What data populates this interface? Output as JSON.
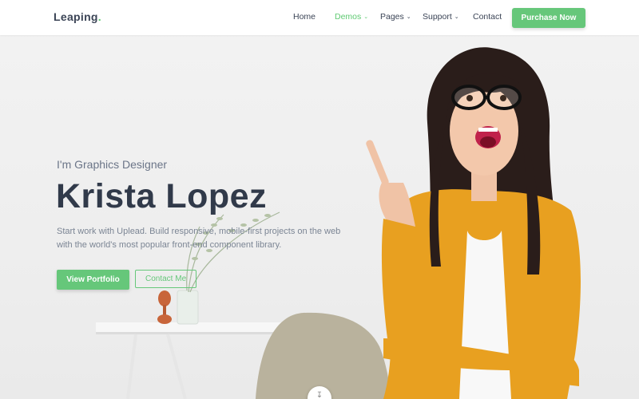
{
  "brand": {
    "name": "Leaping",
    "dot": "."
  },
  "nav": {
    "items": [
      {
        "label": "Home",
        "active": false,
        "dropdown": false
      },
      {
        "label": "Demos",
        "active": true,
        "dropdown": true
      },
      {
        "label": "Pages",
        "active": false,
        "dropdown": true
      },
      {
        "label": "Support",
        "active": false,
        "dropdown": true
      },
      {
        "label": "Contact",
        "active": false,
        "dropdown": false
      }
    ],
    "cta": "Purchase Now"
  },
  "hero": {
    "subtitle": "I'm Graphics Designer",
    "name": "Krista Lopez",
    "description": "Start work with Uplead. Build responsive, mobile-first projects on the web with the world's most popular front-end component library.",
    "primary_button": "View Portfolio",
    "secondary_button": "Contact Me",
    "scroll_icon": "mouse-scroll-icon"
  },
  "colors": {
    "accent": "#66c77a",
    "text_dark": "#313a4a",
    "text_muted": "#7b8594",
    "cardigan": "#e8a020"
  }
}
